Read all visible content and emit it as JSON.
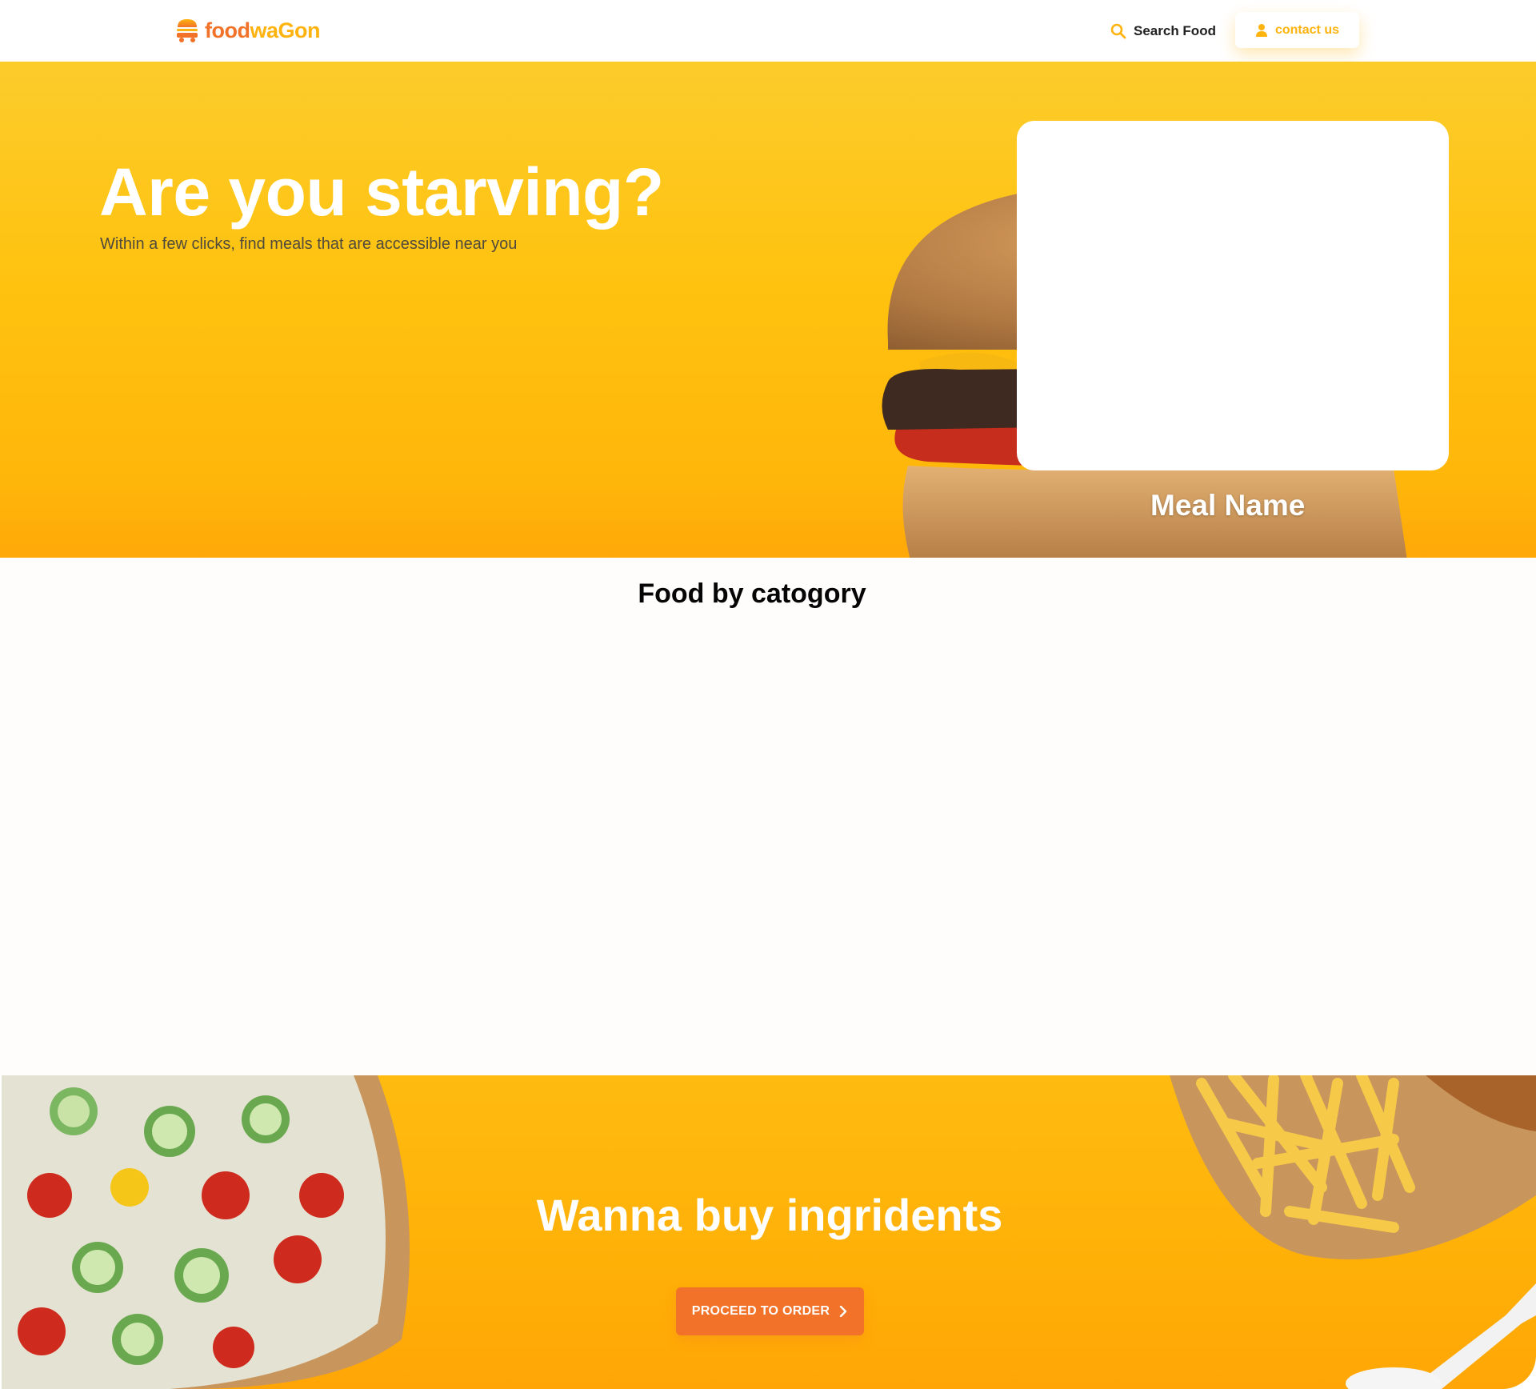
{
  "navbar": {
    "logo": {
      "part1": "food",
      "part2": "waGon"
    },
    "search_label": "Search Food",
    "contact_label": "contact us"
  },
  "hero": {
    "title": "Are you starving?",
    "subtitle": "Within a few clicks, find meals that are accessible near you",
    "meal_name": "Meal Name"
  },
  "category": {
    "title": "Food by catogory"
  },
  "banner": {
    "title": "Wanna buy ingridents",
    "button_label": "PROCEED TO ORDER"
  },
  "colors": {
    "accent_orange": "#f17228",
    "accent_yellow": "#ffb30e",
    "hero_yellow": "#ffc20f"
  },
  "icons": {
    "logo": "food-truck-burger-icon",
    "search": "search-icon",
    "contact": "user-icon",
    "order": "chevron-right-icon"
  }
}
